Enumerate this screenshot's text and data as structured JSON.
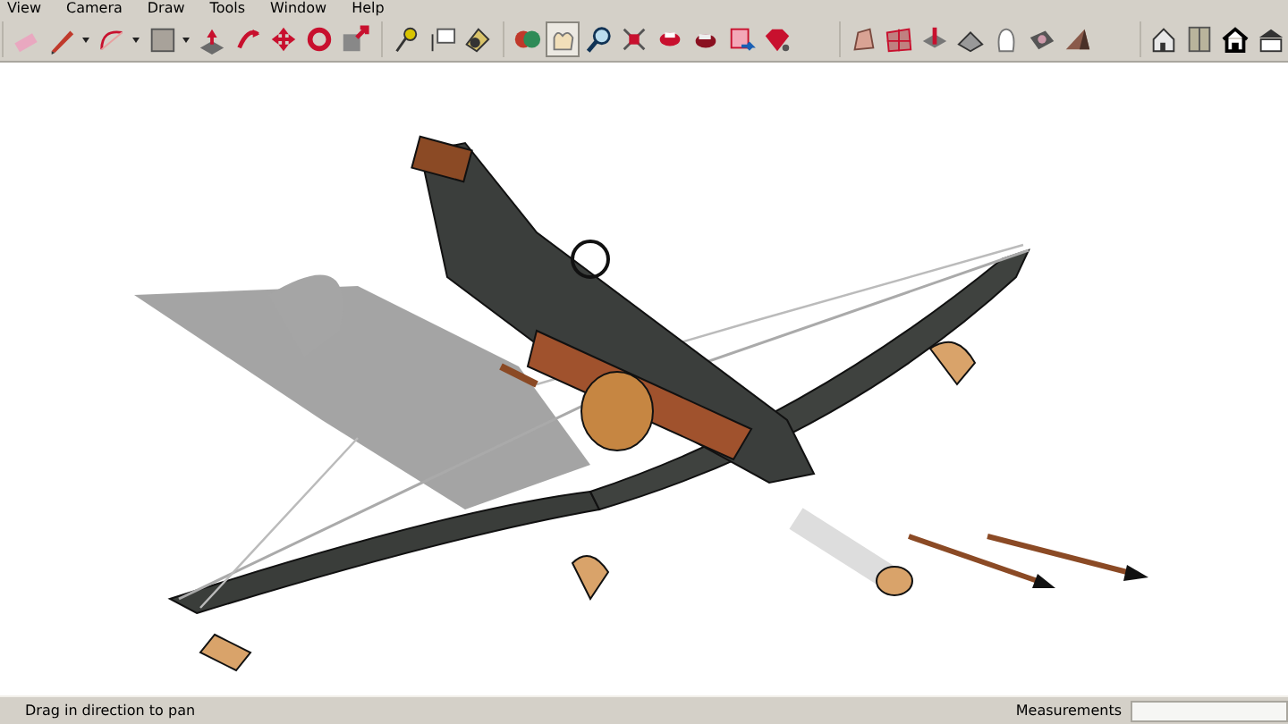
{
  "menu_bar": {
    "items": [
      "View",
      "Camera",
      "Draw",
      "Tools",
      "Window",
      "Help"
    ]
  },
  "toolbar": {
    "groups": [
      {
        "tools": [
          {
            "selected": false,
            "dropdown": false
          },
          {
            "selected": false,
            "dropdown": true
          },
          {
            "selected": false,
            "dropdown": true
          },
          {
            "selected": false,
            "dropdown": true
          },
          {
            "selected": false,
            "dropdown": false
          },
          {
            "selected": false,
            "dropdown": false
          },
          {
            "selected": false,
            "dropdown": false
          },
          {
            "selected": false,
            "dropdown": false
          },
          {
            "selected": false,
            "dropdown": false
          }
        ]
      },
      {
        "tools": [
          {
            "selected": false,
            "dropdown": false
          },
          {
            "selected": false,
            "dropdown": false
          },
          {
            "selected": false,
            "dropdown": false
          }
        ]
      },
      {
        "tools": [
          {
            "selected": false,
            "dropdown": false
          },
          {
            "selected": true,
            "dropdown": false
          },
          {
            "selected": false,
            "dropdown": false
          },
          {
            "selected": false,
            "dropdown": false
          },
          {
            "selected": false,
            "dropdown": false
          },
          {
            "selected": false,
            "dropdown": false
          },
          {
            "selected": false,
            "dropdown": false
          },
          {
            "selected": false,
            "dropdown": false
          }
        ]
      },
      {
        "tools": [
          {
            "selected": false,
            "dropdown": false
          },
          {
            "selected": false,
            "dropdown": false
          },
          {
            "selected": false,
            "dropdown": false
          },
          {
            "selected": false,
            "dropdown": false
          },
          {
            "selected": false,
            "dropdown": false
          },
          {
            "selected": false,
            "dropdown": false
          },
          {
            "selected": false,
            "dropdown": false
          }
        ]
      },
      {
        "tools": [
          {
            "selected": false,
            "dropdown": false
          },
          {
            "selected": false,
            "dropdown": false
          },
          {
            "selected": false,
            "dropdown": false
          },
          {
            "selected": false,
            "dropdown": false
          }
        ]
      }
    ]
  },
  "status_bar": {
    "hint": "Drag in direction to pan",
    "measurements_label": "Measurements"
  }
}
